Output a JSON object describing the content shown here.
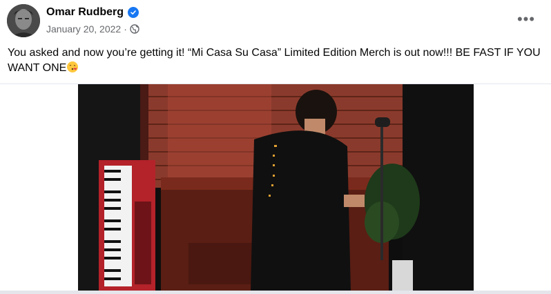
{
  "post": {
    "author": "Omar Rudberg",
    "verified": true,
    "date": "January 20, 2022",
    "separator": "·",
    "audience_icon": "globe-icon",
    "more_label": "•••",
    "text": "You asked and now you’re getting it! “Mi Casa Su Casa” Limited Edition Merch is out now!!! BE FAST IF YOU WANT ONE",
    "emoji": "face-blowing-kiss",
    "photo_alt": "Person in black t-shirt sitting at a piano in front of a brick wall with a red keyboard"
  },
  "colors": {
    "verified": "#1877f2",
    "meta_text": "#65676b",
    "text": "#050505",
    "divider": "#e4e6eb"
  }
}
